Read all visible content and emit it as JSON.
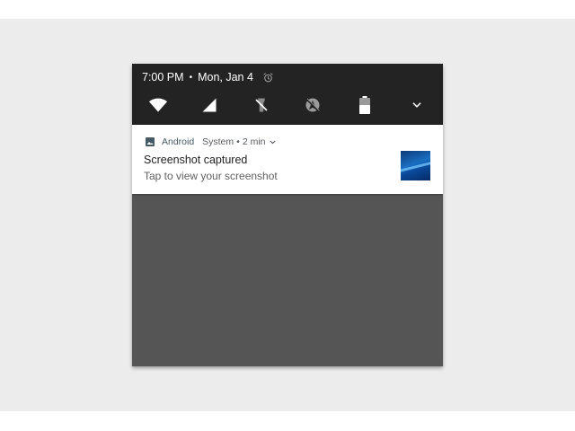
{
  "status_bar": {
    "time": "7:00 PM",
    "separator": "•",
    "date": "Mon, Jan 4"
  },
  "quick_settings": {
    "tiles": [
      "wifi-icon",
      "cellular-signal-icon",
      "flashlight-off-icon",
      "location-off-icon",
      "battery-icon"
    ],
    "expand_icon": "chevron-down-icon"
  },
  "notification": {
    "app_name": "Android",
    "source": "System",
    "separator": "•",
    "time_ago": "2 min",
    "title": "Screenshot captured",
    "text": "Tap to view your screenshot"
  },
  "colors": {
    "status_bar_bg": "#232323",
    "shade_bg": "#555555",
    "backdrop_bg": "#ececec",
    "notification_bg": "#ffffff"
  }
}
